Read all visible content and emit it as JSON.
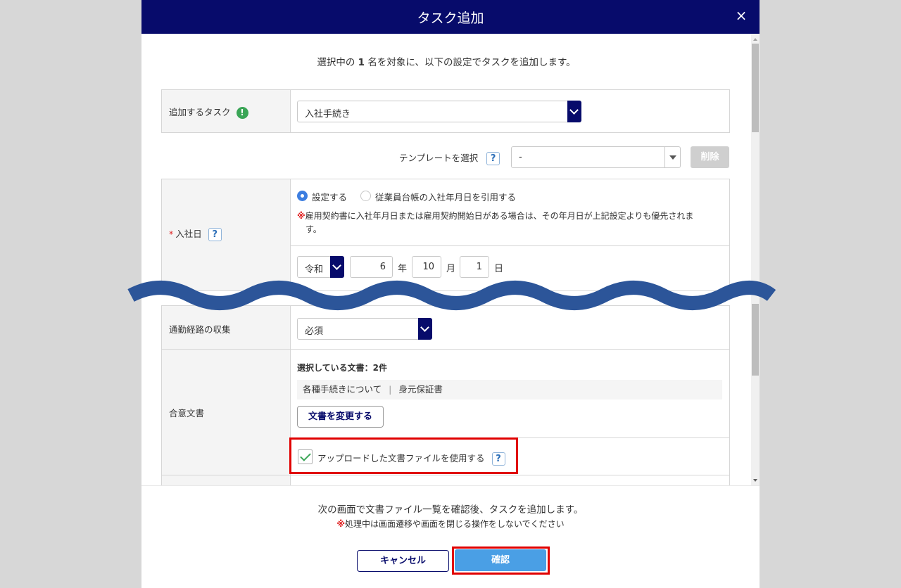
{
  "dialog": {
    "title": "タスク追加",
    "close": "×"
  },
  "intro": {
    "before": "選択中の",
    "count": "1",
    "after": "名を対象に、以下の設定でタスクを追加します。"
  },
  "task_field": {
    "label": "追加するタスク",
    "info_icon": "!",
    "value": "入社手続き"
  },
  "template": {
    "label": "テンプレートを選択",
    "help": "?",
    "value": "-",
    "delete_label": "削除"
  },
  "hire_date": {
    "required_mark": "*",
    "label": "入社日",
    "help": "?",
    "options": [
      "設定する",
      "従業員台帳の入社年月日を引用する"
    ],
    "selected_option": "設定する",
    "note_mark": "※",
    "note_line1": "雇用契約書に入社年月日または雇用契約開始日がある場合は、その年月日が上記設定よりも優先されま",
    "note_line2": "す。",
    "era": "令和",
    "year": "6",
    "year_unit": "年",
    "month": "10",
    "month_unit": "月",
    "day": "1",
    "day_unit": "日"
  },
  "commute": {
    "label": "通勤経路の収集",
    "value": "必須"
  },
  "consent_docs": {
    "label": "合意文書",
    "selected_heading": "選択している文書：2件",
    "doc1": "各種手続きについて",
    "separator": "|",
    "doc2": "身元保証書",
    "change_button": "文書を変更する",
    "upload_checkbox_label": "アップロードした文書ファイルを使用する",
    "upload_checked": true,
    "help": "?"
  },
  "footer": {
    "note": "次の画面で文書ファイル一覧を確認後、タスクを追加します。",
    "warn_mark": "※",
    "warning": "処理中は画面遷移や画面を閉じる操作をしないでください",
    "cancel": "キャンセル",
    "confirm": "確認"
  },
  "colors": {
    "header": "#070b6b",
    "primary_button": "#4a9fe5",
    "highlight_box": "#e00000",
    "wave_divider": "#2c5599"
  }
}
